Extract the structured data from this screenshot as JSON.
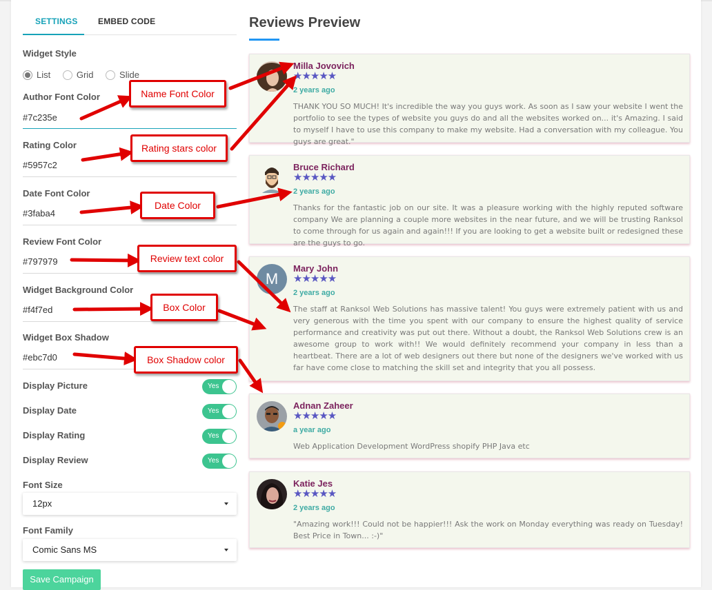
{
  "tabs": {
    "settings": "SETTINGS",
    "embed": "EMBED CODE"
  },
  "settings": {
    "widget_style_label": "Widget Style",
    "style_options": [
      "List",
      "Grid",
      "Slide"
    ],
    "author_font_color_label": "Author Font Color",
    "author_font_color": "#7c235e",
    "rating_color_label": "Rating Color",
    "rating_color": "#5957c2",
    "date_font_color_label": "Date Font Color",
    "date_font_color": "#3faba4",
    "review_font_color_label": "Review Font Color",
    "review_font_color": "#797979",
    "bg_color_label": "Widget Background Color",
    "bg_color": "#f4f7ed",
    "box_shadow_label": "Widget Box Shadow",
    "box_shadow": "#ebc7d0",
    "display_picture_label": "Display Picture",
    "display_date_label": "Display Date",
    "display_rating_label": "Display Rating",
    "display_review_label": "Display Review",
    "toggle_yes": "Yes",
    "font_size_label": "Font Size",
    "font_size": "12px",
    "font_family_label": "Font Family",
    "font_family": "Comic Sans MS",
    "save_label": "Save Campaign"
  },
  "preview": {
    "title": "Reviews Preview",
    "stars": "★★★★★",
    "reviews": [
      {
        "name": "Milla Jovovich",
        "date": "2 years ago",
        "text": "THANK YOU SO MUCH! It's incredible the way you guys work. As soon as I saw your website I went the portfolio to see the types of website you guys do and all the websites worked on... it's Amazing. I said to myself I have to use this company to make my website. Had a conversation with my colleague. You guys are great.\""
      },
      {
        "name": "Bruce Richard",
        "date": "2 years ago",
        "text": "Thanks for the fantastic job on our site. It was a pleasure working with the highly reputed software company We are planning a couple more websites in the near future, and we will be trusting Ranksol to come through for us again and again!!! If you are looking to get a website built or redesigned these are the guys to go."
      },
      {
        "name": "Mary John",
        "initial": "M",
        "date": "2 years ago",
        "text": "The staff at Ranksol Web Solutions has massive talent! You guys were extremely patient with us and very generous with the time you spent with our company to ensure the highest quality of service performance and creativity was put out there. Without a doubt, the Ranksol Web Solutions crew is an awesome group to work with!! We would definitely recommend your company in less than a heartbeat. There are a lot of web designers out there but none of the designers we've worked with us far have come close to matching the skill set and integrity that you all possess."
      },
      {
        "name": "Adnan Zaheer",
        "date": "a year ago",
        "text": "Web Application Development WordPress shopify PHP Java etc"
      },
      {
        "name": "Katie Jes",
        "date": "2 years ago",
        "text": "\"Amazing work!!! Could not be happier!!! Ask the work on Monday everything was ready on Tuesday! Best Price in Town... :-)\""
      }
    ]
  },
  "annotations": {
    "name_font_color": "Name Font Color",
    "rating_stars_color": "Rating stars color",
    "date_color": "Date Color",
    "review_text_color": "Review text color",
    "box_color": "Box Color",
    "box_shadow_color": "Box Shadow color"
  },
  "colors": {
    "accent": "#17a2b8",
    "toggle_on": "#3cc48f",
    "save_button": "#4cd49c",
    "annotation_red": "#e00000",
    "title_underline": "#2196f3"
  }
}
